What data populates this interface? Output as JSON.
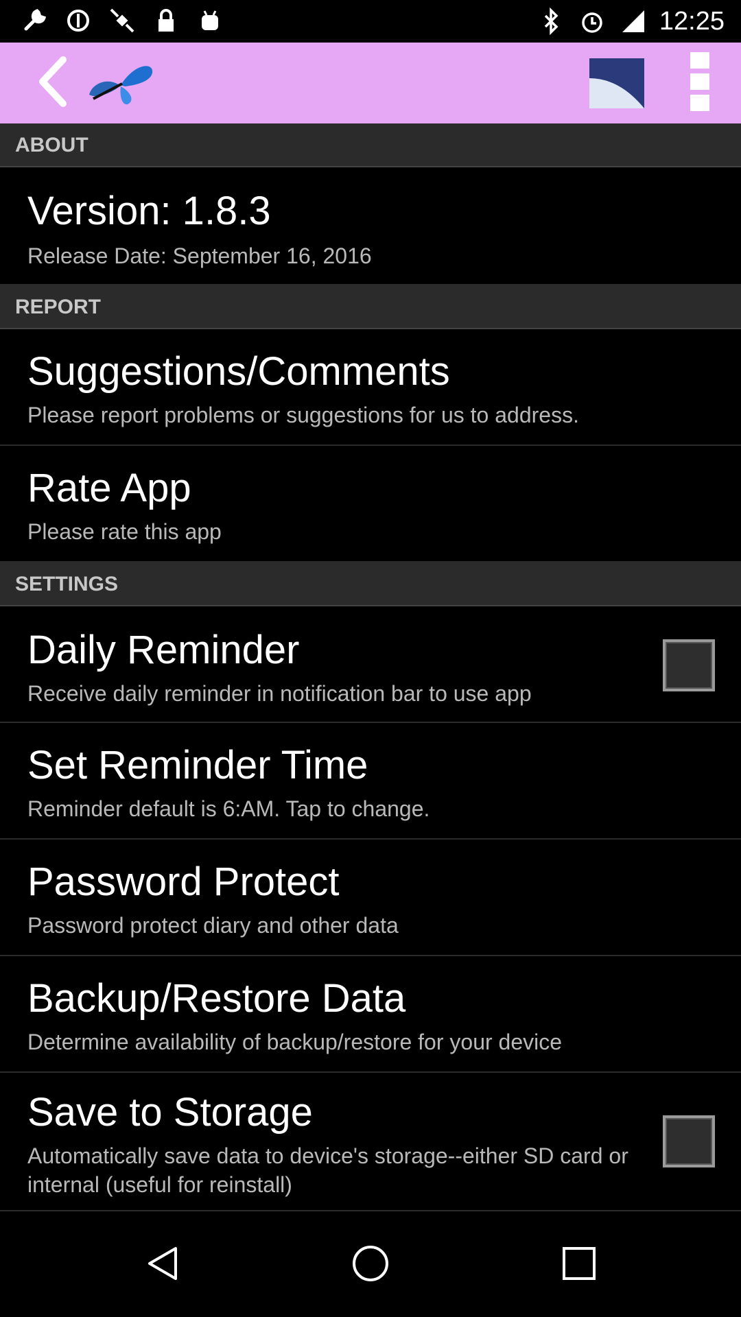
{
  "status_bar": {
    "time": "12:25",
    "icons_left": [
      "wrench-icon",
      "no-sync-icon",
      "satellite-icon",
      "lock-icon",
      "android-icon"
    ],
    "icons_right": [
      "bluetooth-icon",
      "alarm-icon",
      "signal-icon"
    ]
  },
  "action_bar": {
    "color": "#e6a8f5",
    "back_icon": "back-arrow-icon",
    "logo_icon": "butterfly-logo-icon",
    "newsletter_icon": "newsletter-icon",
    "overflow_icon": "more-vertical-icon"
  },
  "about": {
    "header": "ABOUT",
    "version_title": "Version: 1.8.3",
    "release_date": "Release Date: September 16, 2016"
  },
  "report": {
    "header": "REPORT",
    "suggestions_title": "Suggestions/Comments",
    "suggestions_sub": "Please report problems or suggestions for us to address.",
    "rate_title": "Rate App",
    "rate_sub": "Please rate this app"
  },
  "settings": {
    "header": "SETTINGS",
    "daily_title": "Daily Reminder",
    "daily_sub": "Receive daily reminder in notification bar to use app",
    "daily_checked": false,
    "time_title": "Set Reminder Time",
    "time_sub": "Reminder default is 6:AM. Tap to change.",
    "password_title": "Password Protect",
    "password_sub": "Password protect diary and other data",
    "backup_title": "Backup/Restore Data",
    "backup_sub": "Determine availability of backup/restore for your device",
    "storage_title": "Save to Storage",
    "storage_sub": "Automatically save data to device's storage--either SD card or internal (useful for reinstall)",
    "storage_checked": false
  },
  "nav_bar": {
    "back": "nav-back-icon",
    "home": "nav-home-icon",
    "recents": "nav-recents-icon"
  }
}
